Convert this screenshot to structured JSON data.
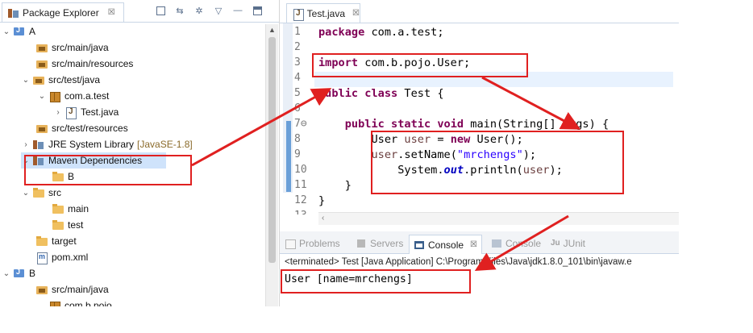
{
  "explorer": {
    "title": "Package Explorer",
    "close_glyph": "☒",
    "tree": [
      {
        "twisty": "⌄",
        "icon": "project-icon",
        "label": "A",
        "suffix": ""
      },
      {
        "twisty": "",
        "icon": "source-folder-icon",
        "label": "src/main/java",
        "suffix": ""
      },
      {
        "twisty": "",
        "icon": "source-folder-icon",
        "label": "src/main/resources",
        "suffix": ""
      },
      {
        "twisty": "⌄",
        "icon": "source-folder-icon",
        "label": "src/test/java",
        "suffix": ""
      },
      {
        "twisty": "⌄",
        "icon": "package-icon",
        "label": "com.a.test",
        "suffix": ""
      },
      {
        "twisty": "›",
        "icon": "java-file-icon",
        "label": "Test.java",
        "suffix": ""
      },
      {
        "twisty": "",
        "icon": "source-folder-icon",
        "label": "src/test/resources",
        "suffix": ""
      },
      {
        "twisty": "›",
        "icon": "library-icon",
        "label": "JRE System Library",
        "suffix": "[JavaSE-1.8]"
      },
      {
        "twisty": "⌄",
        "icon": "library-icon",
        "label": "Maven Dependencies",
        "suffix": ""
      },
      {
        "twisty": "",
        "icon": "folder-icon",
        "label": "B",
        "suffix": ""
      },
      {
        "twisty": "⌄",
        "icon": "folder-icon",
        "label": "src",
        "suffix": ""
      },
      {
        "twisty": "",
        "icon": "folder-icon",
        "label": "main",
        "suffix": ""
      },
      {
        "twisty": "",
        "icon": "folder-icon",
        "label": "test",
        "suffix": ""
      },
      {
        "twisty": "",
        "icon": "folder-icon",
        "label": "target",
        "suffix": ""
      },
      {
        "twisty": "",
        "icon": "xml-file-icon",
        "label": "pom.xml",
        "suffix": ""
      },
      {
        "twisty": "⌄",
        "icon": "project-icon",
        "label": "B",
        "suffix": ""
      },
      {
        "twisty": "",
        "icon": "source-folder-icon",
        "label": "src/main/java",
        "suffix": ""
      },
      {
        "twisty": "",
        "icon": "package-icon",
        "label": "com.b.pojo",
        "suffix": ""
      }
    ]
  },
  "editor": {
    "tab_title": "Test.java",
    "close_glyph": "☒",
    "line_numbers": [
      "1",
      "2",
      "3",
      "4",
      "5",
      "6",
      "7⊖",
      "8",
      "9",
      "10",
      "11",
      "12",
      "13"
    ],
    "lines": {
      "l1_kw": "package",
      "l1_rest": " com.a.test;",
      "l3_kw": "import",
      "l3_rest": " com.b.pojo.User;",
      "l5_kw1": "public",
      "l5_kw2": "class",
      "l5_rest": " Test {",
      "l7_kw1": "public",
      "l7_kw2": "static",
      "l7_kw3": "void",
      "l7_rest": " main(String[] args) {",
      "l8_type": "User ",
      "l8_var": "user",
      "l8_eq": " = ",
      "l8_kw": "new",
      "l8_rest": " User();",
      "l9_var": "user",
      "l9_call": ".setName(",
      "l9_str": "\"mrchengs\"",
      "l9_end": ");",
      "l10_sys": "System.",
      "l10_out": "out",
      "l10_call": ".println(",
      "l10_var": "user",
      "l10_end": ");",
      "l11": "}",
      "l12": "}"
    }
  },
  "console": {
    "tabs": {
      "problems": "Problems",
      "servers": "Servers",
      "console": "Console",
      "console2": "Console",
      "junit_prefix": "Ju",
      "junit": "JUnit"
    },
    "terminated": "<terminated> Test [Java Application] C:\\Program Files\\Java\\jdk1.8.0_101\\bin\\javaw.e",
    "output": "User [name=mrchengs]"
  },
  "colors": {
    "annotation": "#e02020",
    "keyword": "#7f0055",
    "string": "#2a00ff",
    "field": "#0000c0",
    "selection": "#cfe3fb"
  }
}
